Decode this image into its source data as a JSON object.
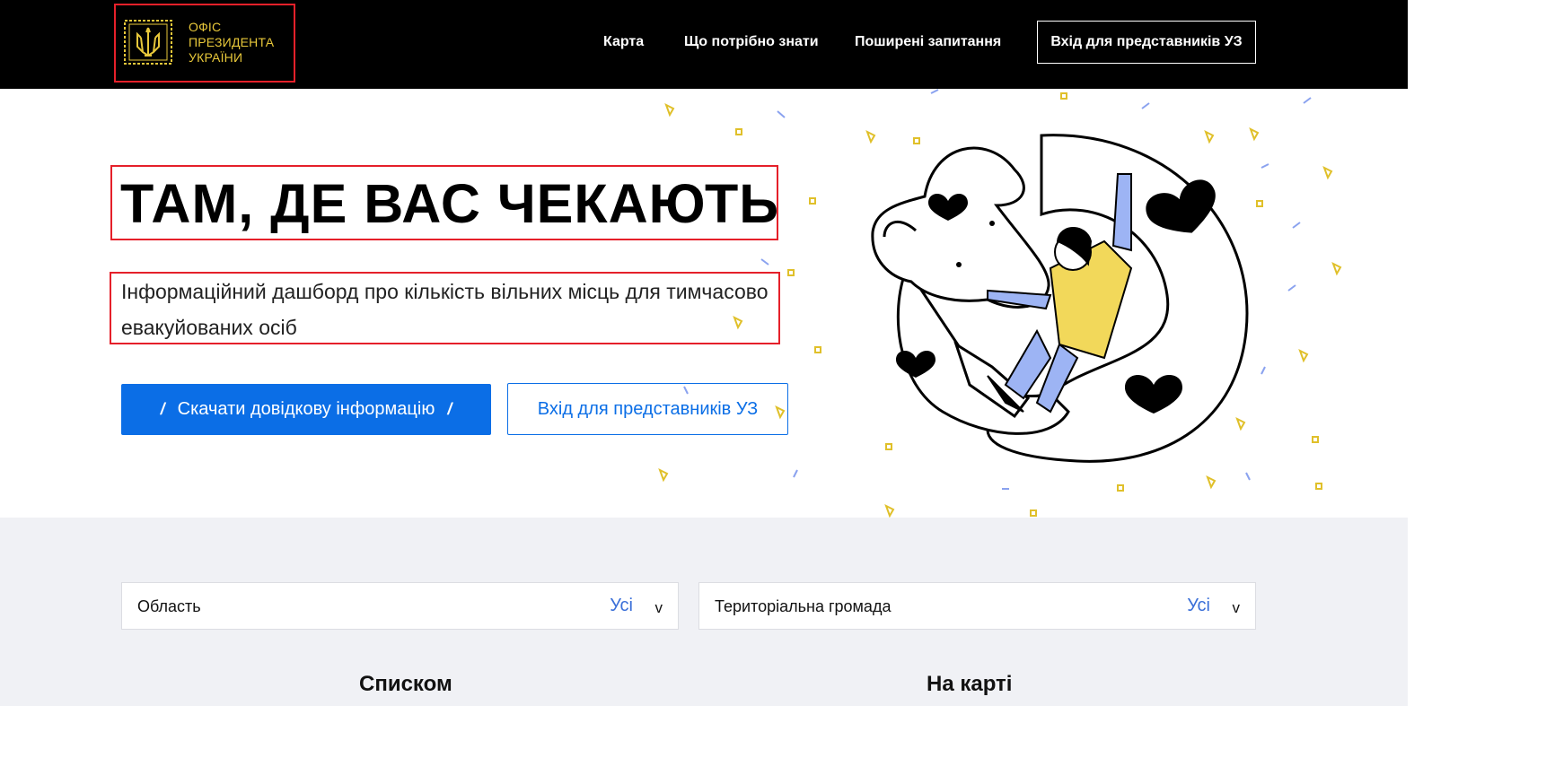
{
  "header": {
    "logo_lines": [
      "ОФІС",
      "ПРЕЗИДЕНТА",
      "УКРАЇНИ"
    ],
    "nav": [
      {
        "label": "Карта"
      },
      {
        "label": "Що потрібно знати"
      },
      {
        "label": "Поширені запитання"
      }
    ],
    "login_button": "Вхід для представників УЗ"
  },
  "hero": {
    "title": "ТАМ, ДЕ ВАС ЧЕКАЮТЬ",
    "subtitle": "Інформаційний дашборд про кількість вільних місць для тимчасово евакуйованих осіб",
    "download_button": "Скачати довідкову інформацію",
    "login_button": "Вхід для представників УЗ"
  },
  "filters": [
    {
      "label": "Область",
      "value": "Усі",
      "chevron": "v"
    },
    {
      "label": "Територіальна громада",
      "value": "Усі",
      "chevron": "v"
    }
  ],
  "tabs": [
    {
      "label": "Списком"
    },
    {
      "label": "На карті"
    }
  ],
  "colors": {
    "header_bg": "#000000",
    "logo_gold": "#e7c73a",
    "primary_blue": "#0b6ee6",
    "link_blue": "#3a6fd8",
    "lower_bg": "#f0f1f5",
    "illustration_blue": "#9db4f4",
    "illustration_yellow": "#f2d85a"
  },
  "icons": [
    "trident-icon",
    "chevron-down-icon"
  ]
}
